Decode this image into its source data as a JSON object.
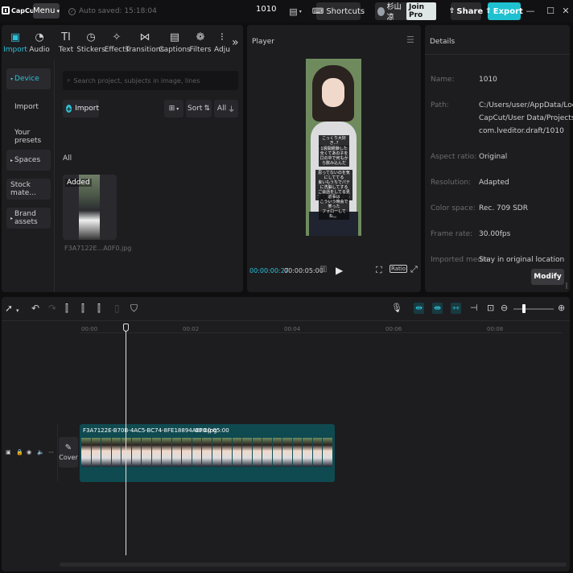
{
  "app": {
    "logo_text": "CapCut",
    "menu_label": "Menu",
    "autosave_text": "Auto saved: 15:18:04",
    "project_title": "1010",
    "shortcuts_label": "Shortcuts",
    "user_name": "杉山凉",
    "join_pro_label": "Join Pro",
    "share_label": "Share",
    "export_label": "Export",
    "accent_color": "#2ec0d6"
  },
  "media": {
    "tabs": [
      {
        "label": "Import",
        "icon": "import-icon"
      },
      {
        "label": "Audio",
        "icon": "audio-icon"
      },
      {
        "label": "Text",
        "icon": "text-icon"
      },
      {
        "label": "Stickers",
        "icon": "stickers-icon"
      },
      {
        "label": "Effects",
        "icon": "effects-icon"
      },
      {
        "label": "Transitions",
        "icon": "transitions-icon"
      },
      {
        "label": "Captions",
        "icon": "captions-icon"
      },
      {
        "label": "Filters",
        "icon": "filters-icon"
      },
      {
        "label": "Adju",
        "icon": "adjust-icon"
      }
    ],
    "nav": {
      "device": "Device",
      "import": "Import",
      "your_presets": "Your presets",
      "spaces": "Spaces",
      "stock": "Stock mate...",
      "brand": "Brand assets"
    },
    "search_placeholder": "Search project, subjects in image, lines",
    "import_button": "Import",
    "sort_label": "Sort",
    "filter_all": "All",
    "all_label": "All",
    "item": {
      "badge": "Added",
      "name": "F3A7122E...A0F0.jpg"
    }
  },
  "player": {
    "title": "Player",
    "captions": [
      "こっくり大好き..?",
      "1週間経験した\n全くてあの子を\n口の中で何もから飲み込んだ",
      "思ってないのを気にしててる\n良いもうちでパテに洗脳してする\nご会話をしてる見ててとだっためる",
      "返事は\nこういう時会で笑った\nフォローしてね。。"
    ],
    "time_current": "00:00:00:27",
    "time_total": "00:00:05:00",
    "ratio_label": "Ratio"
  },
  "details": {
    "title": "Details",
    "rows": [
      {
        "label": "Name:",
        "value": "1010"
      },
      {
        "label": "Path:",
        "value": "C:/Users/user/AppData/Local/\nCapCut/User Data/Projects/\ncom.lveditor.draft/1010"
      },
      {
        "label": "Aspect ratio:",
        "value": "Original"
      },
      {
        "label": "Resolution:",
        "value": "Adapted"
      },
      {
        "label": "Color space:",
        "value": "Rec. 709 SDR"
      },
      {
        "label": "Frame rate:",
        "value": "30.00fps"
      },
      {
        "label": "Imported media:",
        "value": "Stay in original location"
      }
    ],
    "modify_label": "Modify"
  },
  "timeline": {
    "ticks": [
      "00:00",
      "00:02",
      "00:04",
      "00:06",
      "00:08"
    ],
    "cover_label": "Cover",
    "clip_name": "F3A7122E-B70B-4AC5-BC74-8FE18894A0F0.jpg",
    "clip_duration": "00:00:05:00",
    "playhead_seconds": 0.9,
    "zoom_level": 0.22
  }
}
